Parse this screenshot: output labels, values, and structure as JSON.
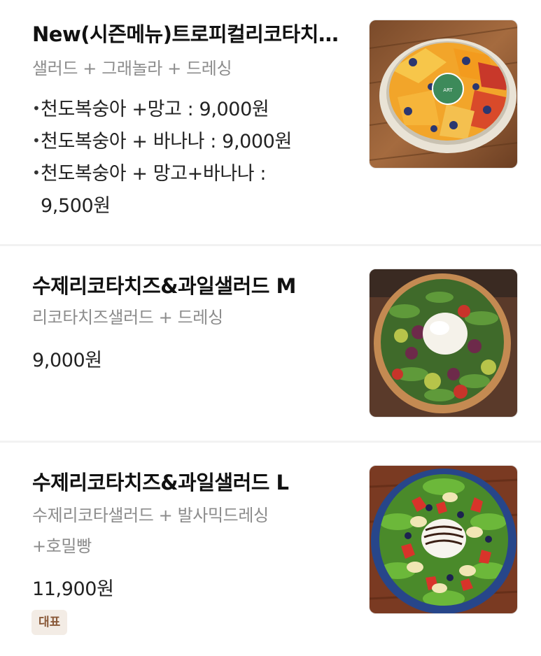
{
  "menu": {
    "items": [
      {
        "title": "New(시즌메뉴)트로피컬리코타치즈샐러드",
        "description": "샐러드 + 그래놀라 + 드레싱",
        "options": [
          "천도복숭아 +망고 : 9,000원",
          "천도복숭아 + 바나나 : 9,000원",
          "천도복숭아 + 망고+바나나 :",
          "9,500원"
        ],
        "image": "tropical-salad-photo",
        "image_logo_text": "PANGGGGONG ART FACTORY"
      },
      {
        "title": "수제리코타치즈&과일샐러드 M",
        "description": "리코타치즈샐러드 + 드레싱",
        "price": "9,000원",
        "image": "ricotta-salad-m-photo"
      },
      {
        "title": "수제리코타치즈&과일샐러드 L",
        "description_line1": "수제리코타샐러드 + 발사믹드레싱",
        "description_line2": "+호밀빵",
        "price": "11,900원",
        "badge": "대표",
        "image": "ricotta-salad-l-photo"
      }
    ]
  },
  "colors": {
    "text": "#111111",
    "subtext": "#8c8c8c",
    "divider": "#f2f2f2",
    "badge_bg": "#f3ece5",
    "badge_text": "#8a5a3a"
  }
}
